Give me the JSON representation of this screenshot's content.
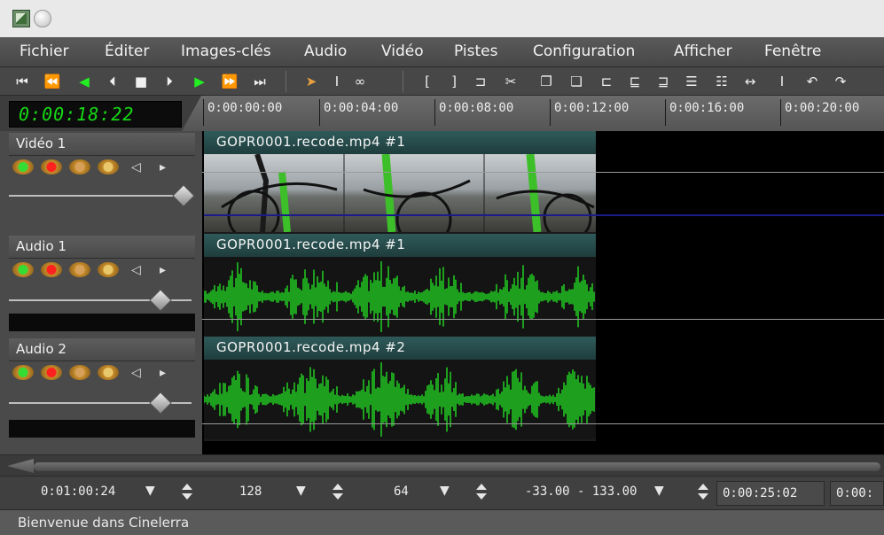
{
  "menu": [
    "Fichier",
    "Éditer",
    "Images-clés",
    "Audio",
    "Vidéo",
    "Pistes",
    "Configuration",
    "Afficher",
    "Fenêtre"
  ],
  "transport": {
    "icons": [
      "rewind-start-icon",
      "fast-rewind-icon",
      "rewind-icon",
      "frame-back-icon",
      "stop-icon",
      "frame-forward-icon",
      "play-icon",
      "fast-forward-icon",
      "forward-end-icon"
    ]
  },
  "tools": {
    "icons": [
      "arrow-edit-icon",
      "ibeam-select-icon",
      "keyframe-icon",
      "in-point-icon",
      "out-point-icon",
      "label-icon",
      "cut-icon",
      "copy-icon",
      "paste-icon",
      "overwrite-icon",
      "splice-icon",
      "fit-icon",
      "zoom-icon",
      "clip-in-icon",
      "clip-out-icon",
      "expand-icon",
      "undo-icon",
      "redo-icon"
    ]
  },
  "clock": "0:00:18:22",
  "ruler": [
    "0:00:00:00",
    "0:00:04:00",
    "0:00:08:00",
    "0:00:12:00",
    "0:00:16:00",
    "0:00:20:00"
  ],
  "tracks": [
    {
      "name": "Vidéo 1",
      "clip": "GOPR0001.recode.mp4 #1",
      "kind": "video"
    },
    {
      "name": "Audio 1",
      "clip": "GOPR0001.recode.mp4 #1",
      "kind": "audio"
    },
    {
      "name": "Audio 2",
      "clip": "GOPR0001.recode.mp4 #2",
      "kind": "audio"
    }
  ],
  "zoom": {
    "time_zoom": "0:01:00:24",
    "audio_zoom": "128",
    "track_height": "64",
    "curve_range": "-33.00 - 133.00",
    "selection_start": "0:00:25:02",
    "selection_end": "0:00:"
  },
  "status": "Bienvenue dans Cinelerra",
  "colors": {
    "waveform": "#22dd22",
    "clock_digits": "#16d916",
    "clip_title_bg": "#2f5a5a"
  }
}
